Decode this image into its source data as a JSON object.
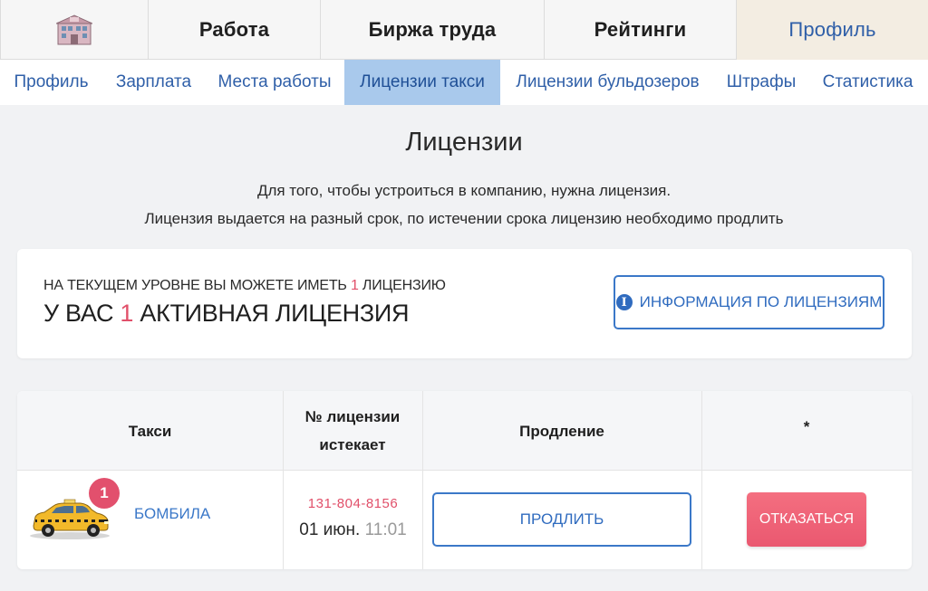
{
  "topnav": {
    "home_icon": "building-icon",
    "tabs": [
      {
        "label": "Работа"
      },
      {
        "label": "Биржа труда"
      },
      {
        "label": "Рейтинги"
      },
      {
        "label": "Профиль"
      }
    ],
    "active_tab": "Профиль"
  },
  "subnav": {
    "items": [
      {
        "label": "Профиль"
      },
      {
        "label": "Зарплата"
      },
      {
        "label": "Места работы"
      },
      {
        "label": "Лицензии такси"
      },
      {
        "label": "Лицензии бульдозеров"
      },
      {
        "label": "Штрафы"
      },
      {
        "label": "Статистика"
      }
    ],
    "active": "Лицензии такси"
  },
  "page": {
    "title": "Лицензии",
    "desc_line1": "Для того, чтобы устроиться в компанию, нужна лицензия.",
    "desc_line2": "Лицензия выдается на разный срок, по истечении срока лицензию необходимо продлить"
  },
  "card": {
    "small_prefix": "На текущем уровне вы можете иметь",
    "small_count": "1",
    "small_suffix": "лицензию",
    "big_prefix": "У вас",
    "big_count": "1",
    "big_suffix": "активная лицензия",
    "info_button": "Информация по лицензиям",
    "info_icon": "info-circle-icon"
  },
  "table": {
    "headers": {
      "taxi": "Такси",
      "license_line1": "№ лицензии",
      "license_line2": "истекает",
      "renewal": "Продление",
      "extra": "*"
    },
    "rows": [
      {
        "taxi_image": "yellow-taxi-car-image",
        "badge": "1",
        "name": "Бомбила",
        "license_number": "131-804-8156",
        "expires_date": "01 июн.",
        "expires_time": "11:01",
        "renew_label": "Продлить",
        "refuse_label": "Отказаться"
      }
    ]
  },
  "colors": {
    "accent_blue": "#3b78c8",
    "accent_red": "#e1506a",
    "active_sub_bg": "#a9c9ec",
    "active_tab_bg": "#f3ede2"
  }
}
